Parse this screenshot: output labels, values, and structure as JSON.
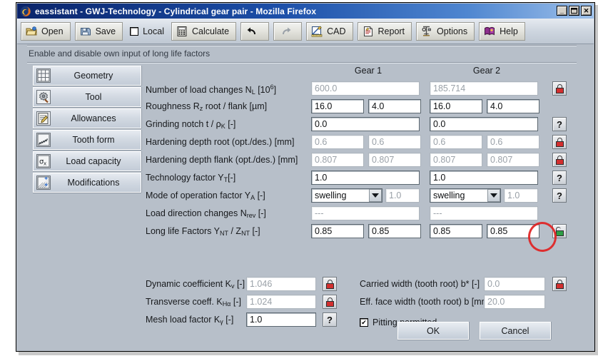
{
  "window": {
    "title": "eassistant - GWJ-Technology - Cylindrical gear pair - Mozilla Firefox",
    "app_icon": "firefox-icon",
    "minimize_label": "_",
    "maximize_label": "❐",
    "close_label": "✕"
  },
  "toolbar": {
    "items": [
      {
        "label": "Open",
        "icon": "open-folder-icon",
        "state": "enabled"
      },
      {
        "label": "Save",
        "icon": "floppy-disk-icon",
        "state": "enabled"
      },
      {
        "label": "Calculate",
        "icon": "calculator-icon",
        "state": "enabled"
      },
      {
        "label": "CAD",
        "icon": "cad-pencil-ruler-icon",
        "state": "enabled"
      },
      {
        "label": "Report",
        "icon": "report-document-icon",
        "state": "enabled"
      },
      {
        "label": "Options",
        "icon": "options-tools-icon",
        "state": "enabled"
      },
      {
        "label": "Help",
        "icon": "help-book-icon",
        "state": "enabled"
      }
    ],
    "local_checkbox": {
      "label": "Local",
      "checked": false
    },
    "undo": {
      "icon": "undo-arrow-icon",
      "state": "enabled"
    },
    "redo": {
      "icon": "redo-arrow-icon",
      "state": "disabled"
    }
  },
  "hint": {
    "text": "Enable and disable own input of long life factors"
  },
  "sidebar": {
    "items": [
      {
        "label": "Geometry",
        "icon": "grid-geometry-icon"
      },
      {
        "label": "Tool",
        "icon": "gear-tool-icon"
      },
      {
        "label": "Allowances",
        "icon": "clipboard-pencil-icon"
      },
      {
        "label": "Tooth form",
        "icon": "tooth-curve-icon"
      },
      {
        "label": "Load capacity",
        "icon": "sigma-x-icon"
      },
      {
        "label": "Modifications",
        "icon": "hatched-plus-icon"
      }
    ]
  },
  "form": {
    "columns": [
      "Gear 1",
      "Gear 2"
    ],
    "rows": [
      {
        "label_html": "Number of load changes N<sub>L</sub> [10<sup>6</sup>]",
        "label_text": "Number of load changes N_L [10^6]",
        "layout": "single",
        "gear1": [
          "600.0"
        ],
        "gear2": [
          "185.714"
        ],
        "readonly": true,
        "trailing": {
          "type": "lock-closed-button",
          "icon": "padlock-closed-red-icon"
        }
      },
      {
        "label_html": "Roughness R<sub>z</sub> root / flank [µm]",
        "label_text": "Roughness Rz root / flank [µm]",
        "layout": "double",
        "gear1": [
          "16.0",
          "4.0"
        ],
        "gear2": [
          "16.0",
          "4.0"
        ],
        "readonly": false,
        "trailing": null
      },
      {
        "label_html": "Grinding notch t / ρ<sub>K</sub> [-]",
        "label_text": "Grinding notch t / rho_K [-]",
        "layout": "single",
        "gear1": [
          "0.0"
        ],
        "gear2": [
          "0.0"
        ],
        "readonly": false,
        "trailing": {
          "type": "help-button",
          "icon": "question-mark-icon",
          "label": "?"
        }
      },
      {
        "label_html": "Hardening depth root (opt./des.) [mm]",
        "label_text": "Hardening depth root (opt./des.) [mm]",
        "layout": "double",
        "gear1": [
          "0.6",
          "0.6"
        ],
        "gear2": [
          "0.6",
          "0.6"
        ],
        "readonly": true,
        "trailing": {
          "type": "lock-closed-button",
          "icon": "padlock-closed-red-icon"
        }
      },
      {
        "label_html": "Hardening depth flank (opt./des.) [mm]",
        "label_text": "Hardening depth flank (opt./des.) [mm]",
        "layout": "double",
        "gear1": [
          "0.807",
          "0.807"
        ],
        "gear2": [
          "0.807",
          "0.807"
        ],
        "readonly": true,
        "trailing": {
          "type": "lock-closed-button",
          "icon": "padlock-closed-red-icon"
        }
      },
      {
        "label_html": "Technology factor Y<sub>T</sub>[-]",
        "label_text": "Technology factor Y_T [-]",
        "layout": "single",
        "gear1": [
          "1.0"
        ],
        "gear2": [
          "1.0"
        ],
        "readonly": false,
        "trailing": {
          "type": "help-button",
          "icon": "question-mark-icon",
          "label": "?"
        }
      },
      {
        "label_html": "Mode of operation factor Y<sub>A</sub> [-]",
        "label_text": "Mode of operation factor Y_A [-]",
        "layout": "combo",
        "gear1": [
          "swelling",
          "1.0"
        ],
        "gear2": [
          "swelling",
          "1.0"
        ],
        "readonly": false,
        "trailing": {
          "type": "help-button",
          "icon": "question-mark-icon",
          "label": "?"
        }
      },
      {
        "label_html": "Load direction changes N<sub>rev</sub> [-]",
        "label_text": "Load direction changes N_rev [-]",
        "layout": "single",
        "gear1": [
          "---"
        ],
        "gear2": [
          "---"
        ],
        "readonly": true,
        "trailing": null
      },
      {
        "label_html": "Long life Factors Y<sub>NT</sub> / Z<sub>NT</sub> [-]",
        "label_text": "Long life Factors Y_NT / Z_NT [-]",
        "layout": "double",
        "gear1": [
          "0.85",
          "0.85"
        ],
        "gear2": [
          "0.85",
          "0.85"
        ],
        "readonly": false,
        "trailing": {
          "type": "lock-open-button",
          "icon": "padlock-open-green-icon",
          "annotated": true
        }
      }
    ]
  },
  "bottom": {
    "left_rows": [
      {
        "label_html": "Dynamic coefficient K<sub>v</sub> [-]",
        "label_text": "Dynamic coefficient K_v [-]",
        "value": "1.046",
        "readonly": true,
        "trailing": {
          "type": "lock-closed-button",
          "icon": "padlock-closed-red-icon"
        }
      },
      {
        "label_html": "Transverse coeff. K<sub>Hα</sub> [-]",
        "label_text": "Transverse coeff. K_Halpha [-]",
        "value": "1.024",
        "readonly": true,
        "trailing": {
          "type": "lock-closed-button",
          "icon": "padlock-closed-red-icon"
        }
      },
      {
        "label_html": "Mesh load factor K<sub>γ</sub> [-]",
        "label_text": "Mesh load factor K_gamma [-]",
        "value": "1.0",
        "readonly": false,
        "trailing": {
          "type": "help-button",
          "icon": "question-mark-icon",
          "label": "?"
        }
      }
    ],
    "right_rows": [
      {
        "label_html": "Carried width (tooth root) b* [-]",
        "label_text": "Carried width (tooth root) b* [-]",
        "value": "0.0",
        "readonly": true,
        "trailing": {
          "type": "lock-closed-button",
          "icon": "padlock-closed-red-icon"
        }
      },
      {
        "label_html": "Eff. face width (tooth root) b [mm]",
        "label_text": "Eff. face width (tooth root) b [mm]",
        "value": "20.0",
        "readonly": true,
        "trailing": null
      }
    ],
    "pitting_checkbox": {
      "label": "Pitting permitted",
      "checked": true,
      "mark": "✔"
    }
  },
  "dialog_buttons": {
    "ok": "OK",
    "cancel": "Cancel"
  },
  "annotation": {
    "shape": "red-ellipse",
    "color": "#e02222",
    "target": "padlock-open-green-icon"
  },
  "colors": {
    "window_bg": "#b7bfc9",
    "titlebar_start": "#0a246a",
    "titlebar_end": "#9dc0ea",
    "lock_closed": "#d32f2f",
    "lock_open": "#2e9e46",
    "annotation": "#e02222",
    "readonly_text": "#9aa1a8"
  }
}
